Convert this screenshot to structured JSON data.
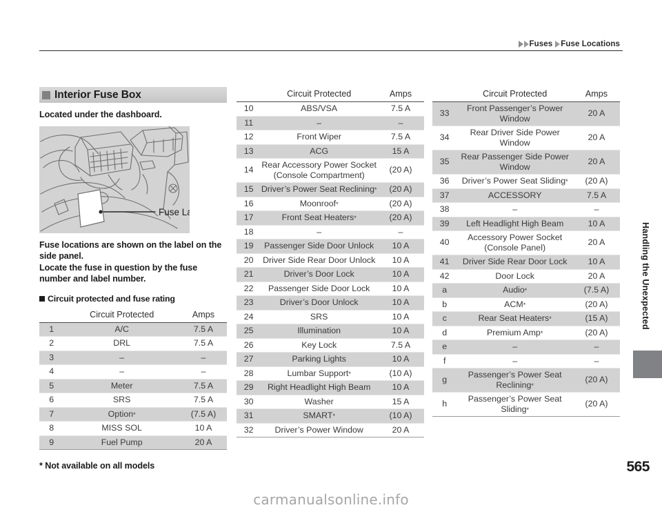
{
  "header": {
    "breadcrumb": [
      "Fuses",
      "Fuse Locations"
    ]
  },
  "left": {
    "section_title": "Interior Fuse Box",
    "intro": "Located under the dashboard.",
    "illustration_label": "Fuse Label",
    "paragraph1": "Fuse locations are shown on the label on the side panel.",
    "paragraph2": "Locate the fuse in question by the fuse number and label number.",
    "sub_head": "Circuit protected and fuse rating"
  },
  "table_headers": {
    "number": "",
    "circuit": "Circuit Protected",
    "amps": "Amps"
  },
  "tables": {
    "left_rows": [
      {
        "num": "1",
        "desc": "A/C",
        "amps": "7.5 A",
        "shaded": true
      },
      {
        "num": "2",
        "desc": "DRL",
        "amps": "7.5 A",
        "shaded": false
      },
      {
        "num": "3",
        "desc": "–",
        "amps": "–",
        "shaded": true
      },
      {
        "num": "4",
        "desc": "–",
        "amps": "–",
        "shaded": false
      },
      {
        "num": "5",
        "desc": "Meter",
        "amps": "7.5 A",
        "shaded": true
      },
      {
        "num": "6",
        "desc": "SRS",
        "amps": "7.5 A",
        "shaded": false
      },
      {
        "num": "7",
        "desc": "Option*",
        "amps": "(7.5 A)",
        "shaded": true
      },
      {
        "num": "8",
        "desc": "MISS SOL",
        "amps": "10 A",
        "shaded": false
      },
      {
        "num": "9",
        "desc": "Fuel Pump",
        "amps": "20 A",
        "shaded": true
      }
    ],
    "mid_rows": [
      {
        "num": "10",
        "desc": "ABS/VSA",
        "amps": "7.5 A",
        "shaded": false
      },
      {
        "num": "11",
        "desc": "–",
        "amps": "–",
        "shaded": true
      },
      {
        "num": "12",
        "desc": "Front Wiper",
        "amps": "7.5 A",
        "shaded": false
      },
      {
        "num": "13",
        "desc": "ACG",
        "amps": "15 A",
        "shaded": true
      },
      {
        "num": "14",
        "desc": "Rear Accessory Power Socket (Console Compartment)",
        "amps": "(20 A)",
        "shaded": false
      },
      {
        "num": "15",
        "desc": "Driver’s Power Seat Reclining*",
        "amps": "(20 A)",
        "shaded": true
      },
      {
        "num": "16",
        "desc": "Moonroof*",
        "amps": "(20 A)",
        "shaded": false
      },
      {
        "num": "17",
        "desc": "Front Seat Heaters*",
        "amps": "(20 A)",
        "shaded": true
      },
      {
        "num": "18",
        "desc": "–",
        "amps": "–",
        "shaded": false
      },
      {
        "num": "19",
        "desc": "Passenger Side Door Unlock",
        "amps": "10 A",
        "shaded": true
      },
      {
        "num": "20",
        "desc": "Driver Side Rear Door Unlock",
        "amps": "10 A",
        "shaded": false
      },
      {
        "num": "21",
        "desc": "Driver’s Door Lock",
        "amps": "10 A",
        "shaded": true
      },
      {
        "num": "22",
        "desc": "Passenger Side Door Lock",
        "amps": "10 A",
        "shaded": false
      },
      {
        "num": "23",
        "desc": "Driver’s Door Unlock",
        "amps": "10 A",
        "shaded": true
      },
      {
        "num": "24",
        "desc": "SRS",
        "amps": "10 A",
        "shaded": false
      },
      {
        "num": "25",
        "desc": "Illumination",
        "amps": "10 A",
        "shaded": true
      },
      {
        "num": "26",
        "desc": "Key Lock",
        "amps": "7.5 A",
        "shaded": false
      },
      {
        "num": "27",
        "desc": "Parking Lights",
        "amps": "10 A",
        "shaded": true
      },
      {
        "num": "28",
        "desc": "Lumbar Support*",
        "amps": "(10 A)",
        "shaded": false
      },
      {
        "num": "29",
        "desc": "Right Headlight High Beam",
        "amps": "10 A",
        "shaded": true
      },
      {
        "num": "30",
        "desc": "Washer",
        "amps": "15 A",
        "shaded": false
      },
      {
        "num": "31",
        "desc": "SMART*",
        "amps": "(10 A)",
        "shaded": true
      },
      {
        "num": "32",
        "desc": "Driver’s Power Window",
        "amps": "20 A",
        "shaded": false
      }
    ],
    "right_rows": [
      {
        "num": "33",
        "desc": "Front Passenger’s Power Window",
        "amps": "20 A",
        "shaded": true
      },
      {
        "num": "34",
        "desc": "Rear Driver Side Power Window",
        "amps": "20 A",
        "shaded": false
      },
      {
        "num": "35",
        "desc": "Rear Passenger Side Power Window",
        "amps": "20 A",
        "shaded": true
      },
      {
        "num": "36",
        "desc": "Driver’s Power Seat Sliding*",
        "amps": "(20 A)",
        "shaded": false
      },
      {
        "num": "37",
        "desc": "ACCESSORY",
        "amps": "7.5 A",
        "shaded": true
      },
      {
        "num": "38",
        "desc": "–",
        "amps": "–",
        "shaded": false
      },
      {
        "num": "39",
        "desc": "Left Headlight High Beam",
        "amps": "10 A",
        "shaded": true
      },
      {
        "num": "40",
        "desc": "Accessory Power Socket (Console Panel)",
        "amps": "20 A",
        "shaded": false
      },
      {
        "num": "41",
        "desc": "Driver Side Rear Door Lock",
        "amps": "10 A",
        "shaded": true
      },
      {
        "num": "42",
        "desc": "Door Lock",
        "amps": "20 A",
        "shaded": false
      },
      {
        "num": "a",
        "desc": "Audio*",
        "amps": "(7.5 A)",
        "shaded": true
      },
      {
        "num": "b",
        "desc": "ACM*",
        "amps": "(20 A)",
        "shaded": false
      },
      {
        "num": "c",
        "desc": "Rear Seat Heaters*",
        "amps": "(15 A)",
        "shaded": true
      },
      {
        "num": "d",
        "desc": "Premium Amp*",
        "amps": "(20 A)",
        "shaded": false
      },
      {
        "num": "e",
        "desc": "–",
        "amps": "–",
        "shaded": true
      },
      {
        "num": "f",
        "desc": "–",
        "amps": "–",
        "shaded": false
      },
      {
        "num": "g",
        "desc": "Passenger’s Power Seat Reclining*",
        "amps": "(20 A)",
        "shaded": true
      },
      {
        "num": "h",
        "desc": "Passenger’s Power Seat Sliding*",
        "amps": "(20 A)",
        "shaded": false
      }
    ]
  },
  "footer": {
    "footnote": "* Not available on all models",
    "chapter": "Handling the Unexpected",
    "page_number": "565",
    "watermark": "carmanualsonline.info"
  },
  "colors": {
    "shade_row": "#d2d2d2",
    "section_bar": "#cfcfcf",
    "tab_block": "#808285",
    "illustration_bg": "#d3d3d3"
  }
}
